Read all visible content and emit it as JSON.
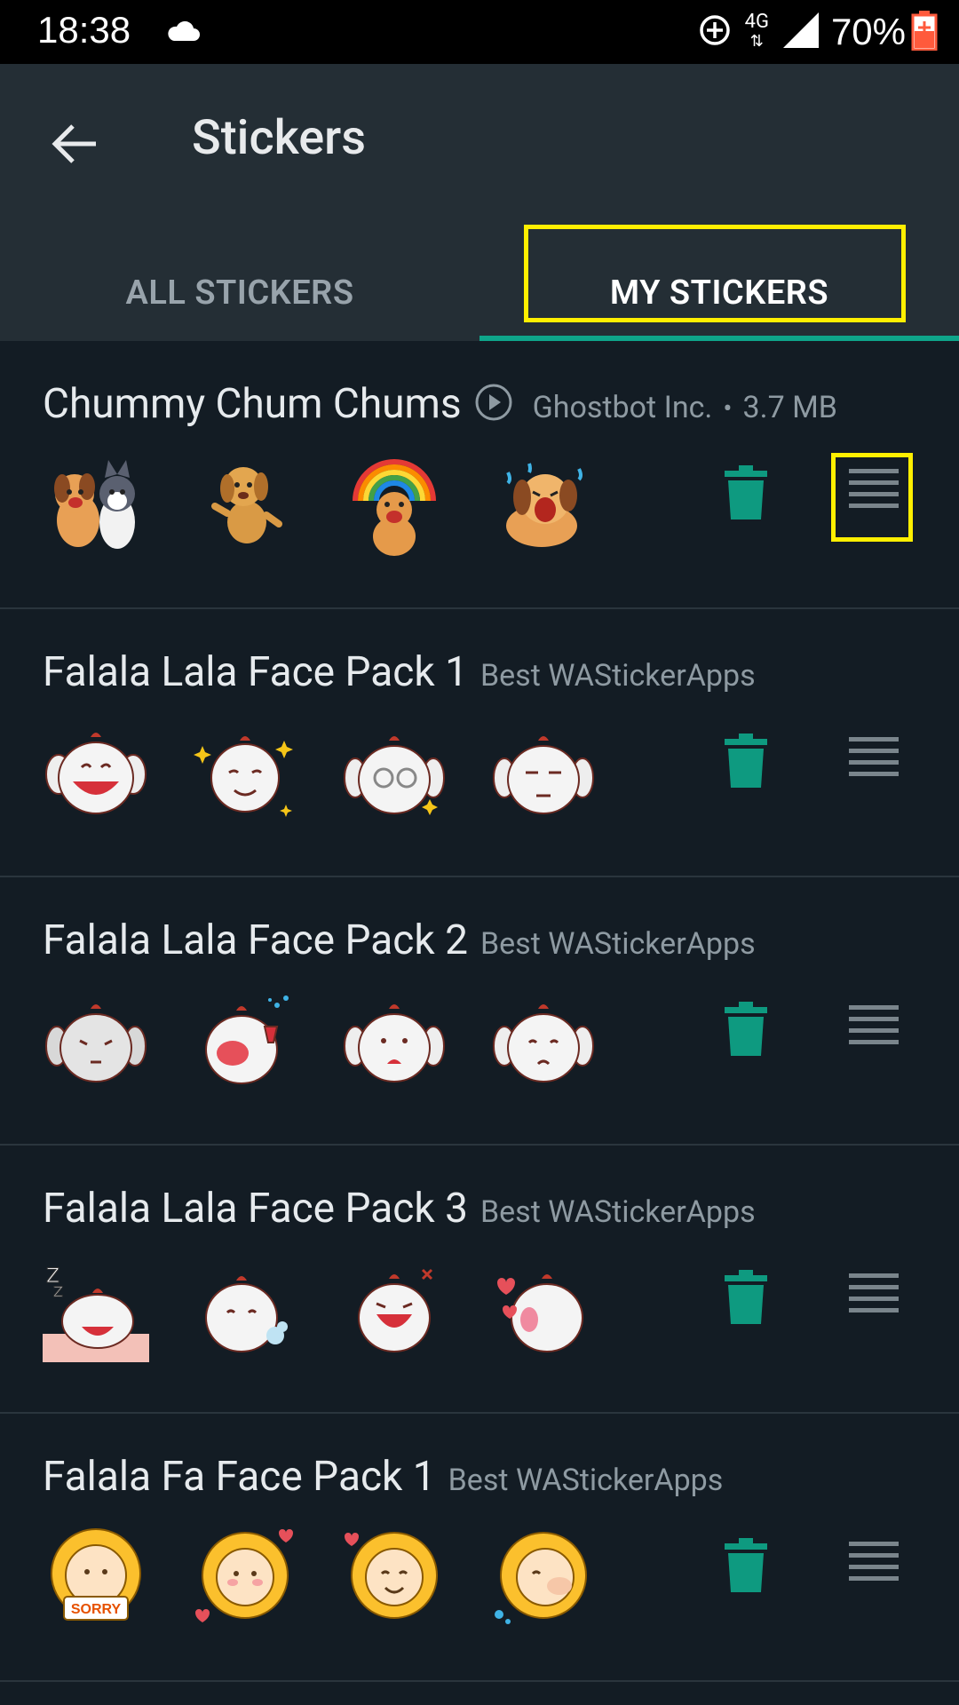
{
  "status_bar": {
    "time": "18:38",
    "network": "4G",
    "battery": "70%"
  },
  "app_bar": {
    "title": "Stickers"
  },
  "tabs": [
    {
      "label": "ALL STICKERS"
    },
    {
      "label": "MY STICKERS"
    }
  ],
  "packs": [
    {
      "name": "Chummy Chum Chums",
      "publisher": "Ghostbot Inc.",
      "size": "3.7 MB",
      "animated": true
    },
    {
      "name": "Falala Lala Face Pack 1",
      "publisher": "Best WAStickerApps"
    },
    {
      "name": "Falala Lala Face Pack 2",
      "publisher": "Best WAStickerApps"
    },
    {
      "name": "Falala Lala Face Pack 3",
      "publisher": "Best WAStickerApps"
    },
    {
      "name": "Falala Fa Face Pack 1",
      "publisher": "Best WAStickerApps"
    }
  ],
  "colors": {
    "accent": "#0ea58a",
    "trash": "#0e9a80",
    "highlight": "#ffef00"
  }
}
